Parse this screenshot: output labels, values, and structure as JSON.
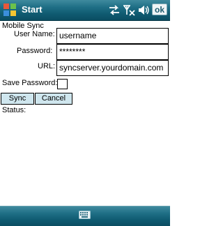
{
  "titlebar": {
    "title": "Start",
    "ok_label": "ok",
    "icons": [
      "sync-arrows-icon",
      "no-signal-icon",
      "speaker-icon"
    ]
  },
  "form": {
    "section_title": "Mobile Sync",
    "username_label": "User Name:",
    "username_value": "username",
    "password_label": "Password:",
    "password_value": "********",
    "url_label": "URL:",
    "url_value": "syncserver.yourdomain.com",
    "save_password_label": "Save Password:",
    "save_password_checked": false,
    "sync_label": "Sync",
    "cancel_label": "Cancel",
    "status_label": "Status:"
  },
  "bottombar": {
    "icons": [
      "keyboard-icon"
    ]
  }
}
